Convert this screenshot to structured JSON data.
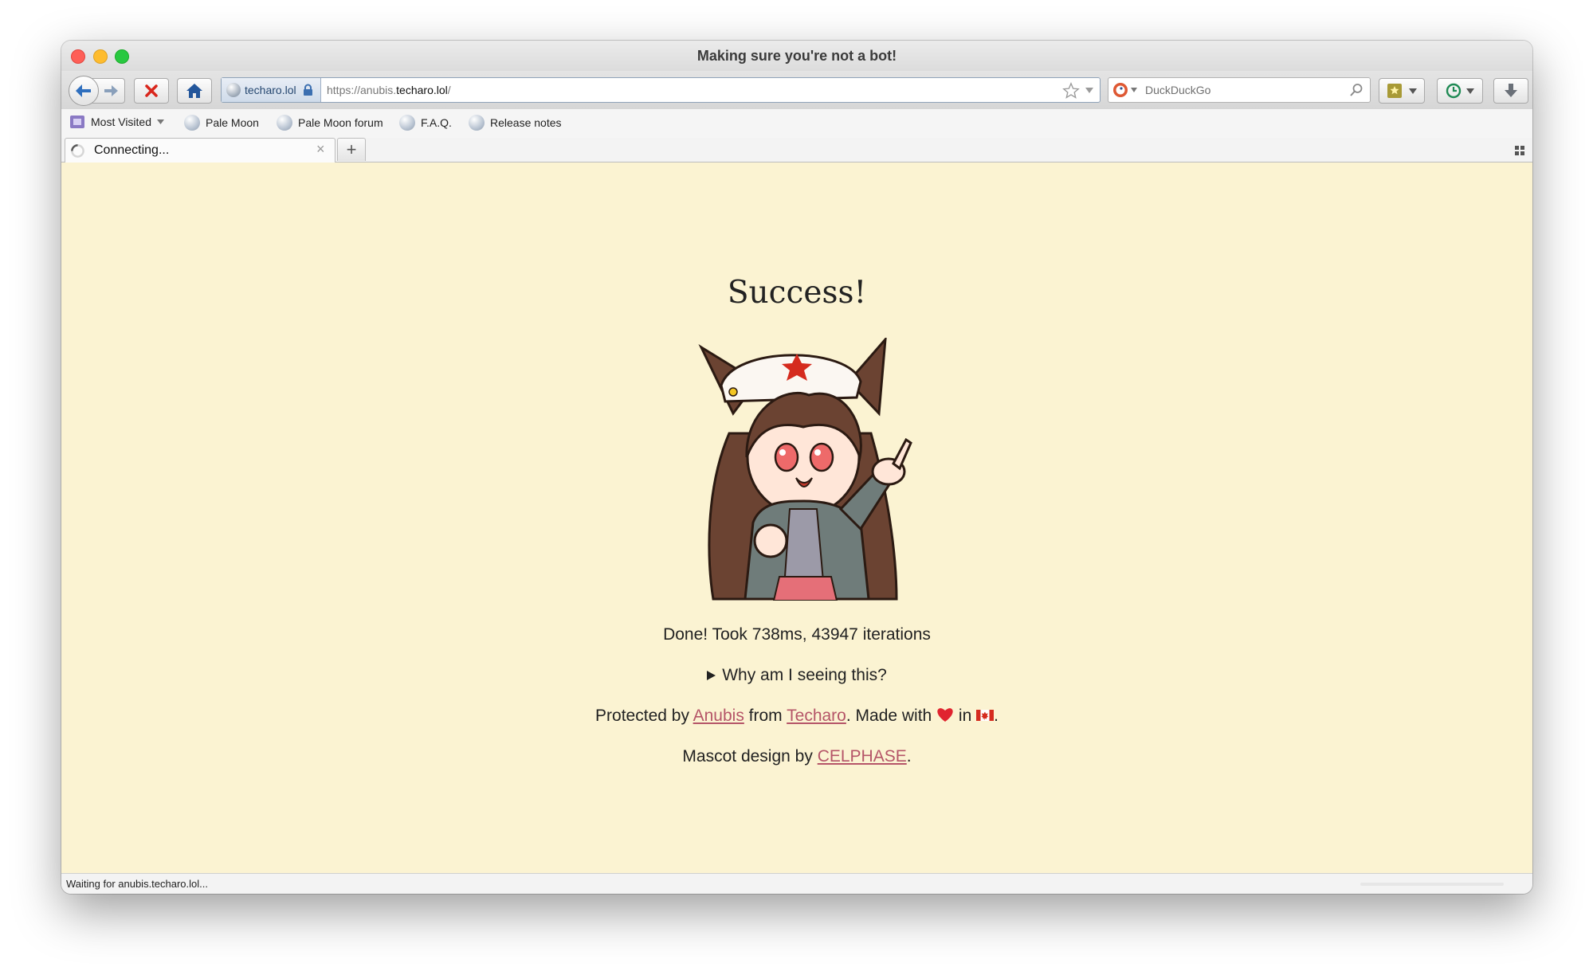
{
  "window": {
    "title": "Making sure you're not a bot!"
  },
  "toolbar": {
    "identity_label": "techaro.lol",
    "url_prefix": "https://anubis.",
    "url_domain": "techaro.lol",
    "url_suffix": "/",
    "search_engine": "DuckDuckGo",
    "search_placeholder": "DuckDuckGo"
  },
  "bookmarks": {
    "most_visited": "Most Visited",
    "items": [
      "Pale Moon",
      "Pale Moon forum",
      "F.A.Q.",
      "Release notes"
    ]
  },
  "tab": {
    "title": "Connecting...",
    "close_glyph": "×",
    "new_tab_glyph": "+"
  },
  "page": {
    "heading": "Success!",
    "result": "Done! Took 738ms, 43947 iterations",
    "details_summary": "Why am I seeing this?",
    "footer": {
      "protected_by": "Protected by ",
      "anubis_link": "Anubis",
      "from": " from ",
      "techaro_link": "Techaro",
      "made_with": ". Made with ",
      "in": " in ",
      "end": "."
    },
    "mascot_credit": {
      "prefix": "Mascot design by ",
      "link": "CELPHASE",
      "suffix": "."
    }
  },
  "status": {
    "text": "Waiting for anubis.techaro.lol..."
  },
  "colors": {
    "page_bg": "#fbf3d2",
    "link": "#b55568",
    "heart": "#e0242f",
    "maple": "#d52b1e"
  }
}
